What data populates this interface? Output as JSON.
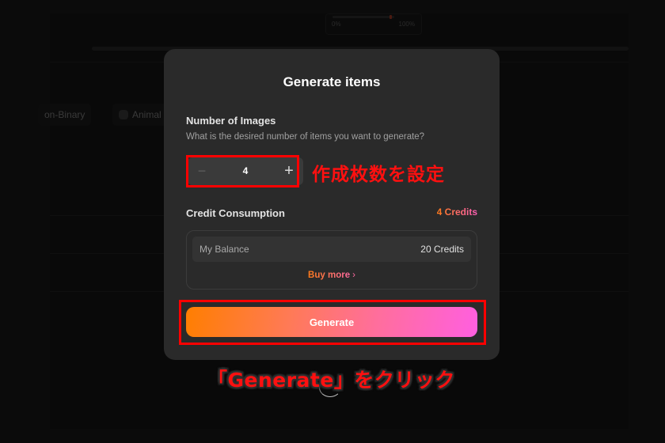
{
  "background": {
    "progress": {
      "min_label": "0%",
      "max_label": "100%",
      "value_percent": 96
    },
    "chips": [
      {
        "label": "on-Binary"
      },
      {
        "label": "Animal"
      }
    ]
  },
  "modal": {
    "title": "Generate items",
    "number_section": {
      "label": "Number of Images",
      "description": "What is the desired number of items you want to generate?"
    },
    "stepper": {
      "minus_icon": "−",
      "value": "4",
      "plus_icon": "+"
    },
    "credit_section": {
      "label": "Credit Consumption",
      "consumption": "4 Credits"
    },
    "balance": {
      "label": "My Balance",
      "value": "20 Credits",
      "buy_more": "Buy more",
      "buy_more_icon": "›"
    },
    "generate_button": "Generate"
  },
  "annotations": {
    "stepper_note": "作成枚数を設定",
    "generate_note": "「Generate」をクリック",
    "highlight_color": "#ff0000"
  },
  "colors": {
    "accent_start": "#ff7e00",
    "accent_end": "#ff5fe0",
    "modal_bg": "#2a2a2a"
  }
}
